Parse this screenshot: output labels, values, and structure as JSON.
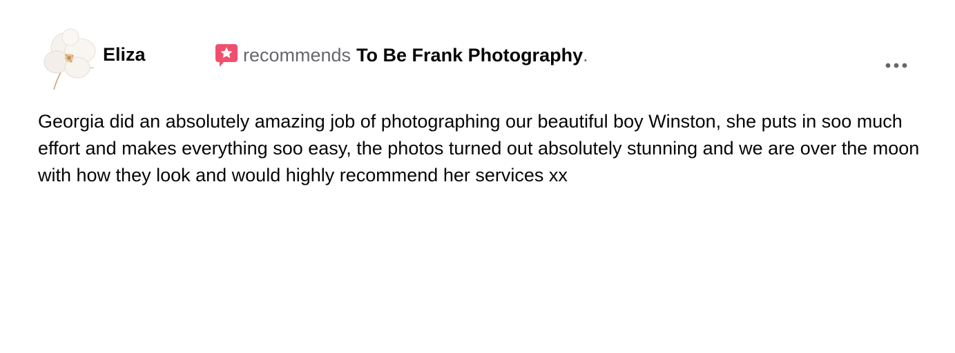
{
  "post": {
    "author": {
      "name": "Eliza",
      "avatar_icon": "flower-avatar-icon"
    },
    "recommendation": {
      "icon": "star-speech-bubble-icon",
      "icon_color": "#f0506e",
      "verb": "recommends",
      "page_name": "To Be Frank Photography",
      "period": "."
    },
    "more_options_icon": "ellipsis-icon",
    "body": "Georgia did an absolutely amazing job of photographing our beautiful boy Winston, she puts in soo much effort and makes everything soo easy, the photos turned out absolutely stunning and we are over the moon with how they look and would highly recommend her services xx"
  }
}
